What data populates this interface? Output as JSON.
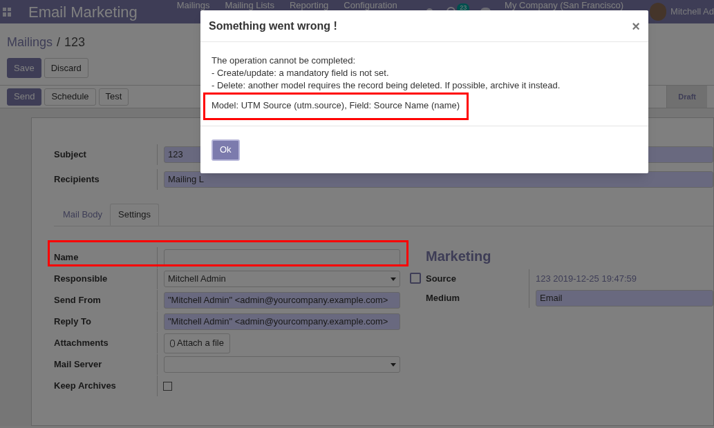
{
  "navbar": {
    "app_title": "Email Marketing",
    "menu": [
      "Mailings",
      "Mailing Lists",
      "Reporting",
      "Configuration"
    ],
    "activity_count": "23",
    "company": "My Company (San Francisco)",
    "user": "Mitchell Ad"
  },
  "breadcrumb": {
    "parent": "Mailings",
    "separator": "/",
    "current": "123"
  },
  "edit_buttons": [
    {
      "label": "Save",
      "primary": true
    },
    {
      "label": "Discard",
      "primary": false
    }
  ],
  "action_buttons": [
    {
      "label": "Send",
      "primary": true
    },
    {
      "label": "Schedule",
      "primary": false
    },
    {
      "label": "Test",
      "primary": false
    }
  ],
  "stages": [
    {
      "label": "Draft",
      "selected": true
    }
  ],
  "header_fields": [
    {
      "label": "Subject",
      "value": "123",
      "required": true
    },
    {
      "label": "Recipients",
      "value": "Mailing L",
      "required": true
    }
  ],
  "tabs": [
    {
      "label": "Mail Body",
      "selected": false
    },
    {
      "label": "Settings",
      "selected": true
    }
  ],
  "settings": [
    {
      "label": "Name",
      "kind": "input",
      "required": false,
      "highlighted": true
    },
    {
      "label": "Responsible",
      "kind": "select",
      "value": "Mitchell Admin",
      "required": false,
      "highlighted": false
    },
    {
      "label": "Send From",
      "kind": "input",
      "value": "\"Mitchell Admin\" <admin@yourcompany.example.com>",
      "required": true,
      "highlighted": false
    },
    {
      "label": "Reply To",
      "kind": "input",
      "value": "\"Mitchell Admin\" <admin@yourcompany.example.com>",
      "required": true,
      "highlighted": false
    },
    {
      "label": "Attachments",
      "kind": "button",
      "value": "Attach a file",
      "highlighted": false
    },
    {
      "label": "Mail Server",
      "kind": "select",
      "required": false,
      "highlighted": false
    },
    {
      "label": "Keep Archives",
      "kind": "checkbox",
      "checked": false,
      "highlighted": false
    }
  ],
  "marketing": {
    "title": "Marketing",
    "fields": [
      {
        "label": "Source",
        "kind": "readonly",
        "value": "123 2019-12-25 19:47:59"
      },
      {
        "label": "Medium",
        "kind": "input",
        "value": "Email",
        "required": true
      }
    ]
  },
  "dialog": {
    "title": "Something went wrong !",
    "close": "×",
    "message": [
      "The operation cannot be completed:",
      "- Create/update: a mandatory field is not set.",
      "- Delete: another model requires the record being deleted. If possible, archive it instead."
    ],
    "detail": "Model: UTM Source (utm.source), Field: Source Name (name)",
    "detail_highlighted": true,
    "button": "Ok"
  }
}
